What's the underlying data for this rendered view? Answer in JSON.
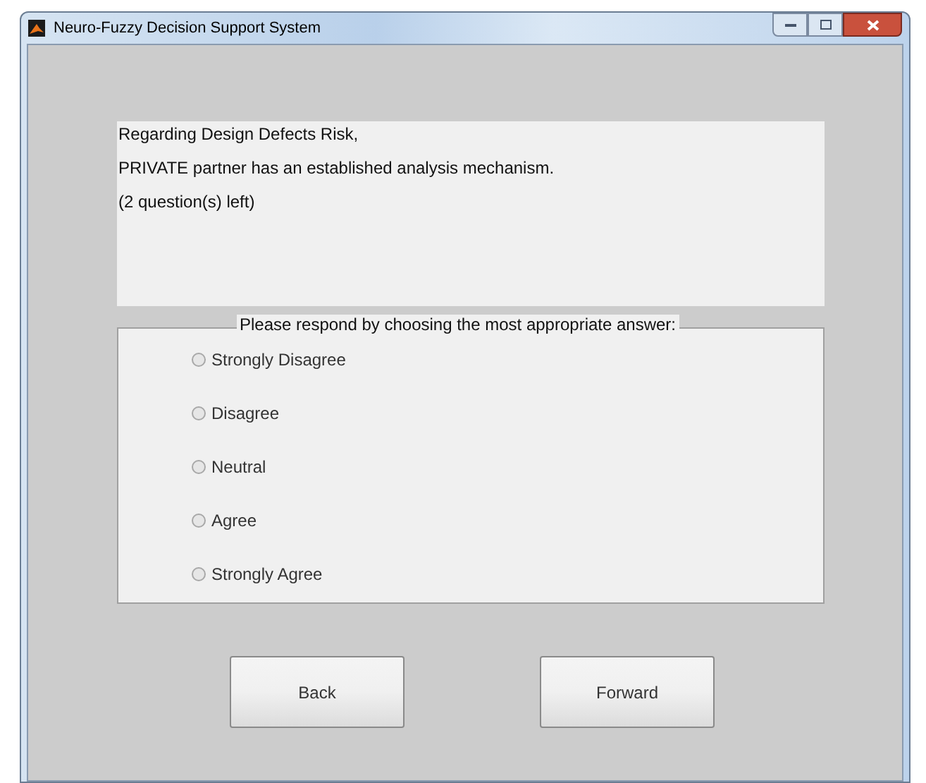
{
  "window": {
    "title": "Neuro-Fuzzy Decision Support System"
  },
  "question": {
    "lines": [
      "Regarding Design Defects Risk,",
      "PRIVATE partner has an established analysis mechanism.",
      "(2 question(s) left)"
    ]
  },
  "answers": {
    "title": "Please respond by choosing the most appropriate answer:",
    "options": [
      {
        "label": "Strongly Disagree",
        "selected": false
      },
      {
        "label": "Disagree",
        "selected": false
      },
      {
        "label": "Neutral",
        "selected": false
      },
      {
        "label": "Agree",
        "selected": false
      },
      {
        "label": "Strongly Agree",
        "selected": false
      }
    ]
  },
  "buttons": [
    "Back",
    "Forward"
  ]
}
